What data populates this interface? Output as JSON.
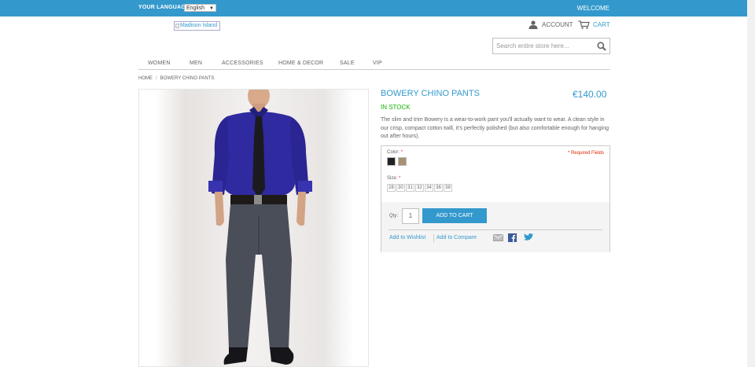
{
  "topbar": {
    "language_label": "YOUR LANGUAGE",
    "language_selected": "English",
    "welcome": "WELCOME"
  },
  "header": {
    "logo_alt": "Madison Island",
    "account_label": "ACCOUNT",
    "cart_label": "CART",
    "search_placeholder": "Search entire store here..."
  },
  "nav": {
    "items": [
      "WOMEN",
      "MEN",
      "ACCESSORIES",
      "HOME & DECOR",
      "SALE",
      "VIP"
    ]
  },
  "breadcrumb": {
    "home": "HOME",
    "separator": "/",
    "current": "BOWERY CHINO PANTS"
  },
  "product": {
    "name": "BOWERY CHINO PANTS",
    "price": "€140.00",
    "availability": "IN STOCK",
    "description": "The slim and trim Bowery is a wear-to-work pant you'll actually want to wear. A clean style in our crisp, compact cotton twill, it's perfectly polished (but also comfortable enough for hanging out after hours)."
  },
  "options": {
    "color_label": "Color:",
    "required_mark": "*",
    "required_fields": "* Required Fields",
    "colors": [
      "#222222",
      "#a89072"
    ],
    "size_label": "Size:",
    "sizes": [
      "28",
      "30",
      "31",
      "32",
      "34",
      "36",
      "38"
    ]
  },
  "cart": {
    "qty_label": "Qty:",
    "qty_value": "1",
    "add_to_cart": "ADD TO CART",
    "wishlist": "Add to Wishlist",
    "compare": "Add to Compare"
  },
  "colors": {
    "accent": "#3399cc",
    "in_stock": "#11b400",
    "required": "#df280a"
  }
}
